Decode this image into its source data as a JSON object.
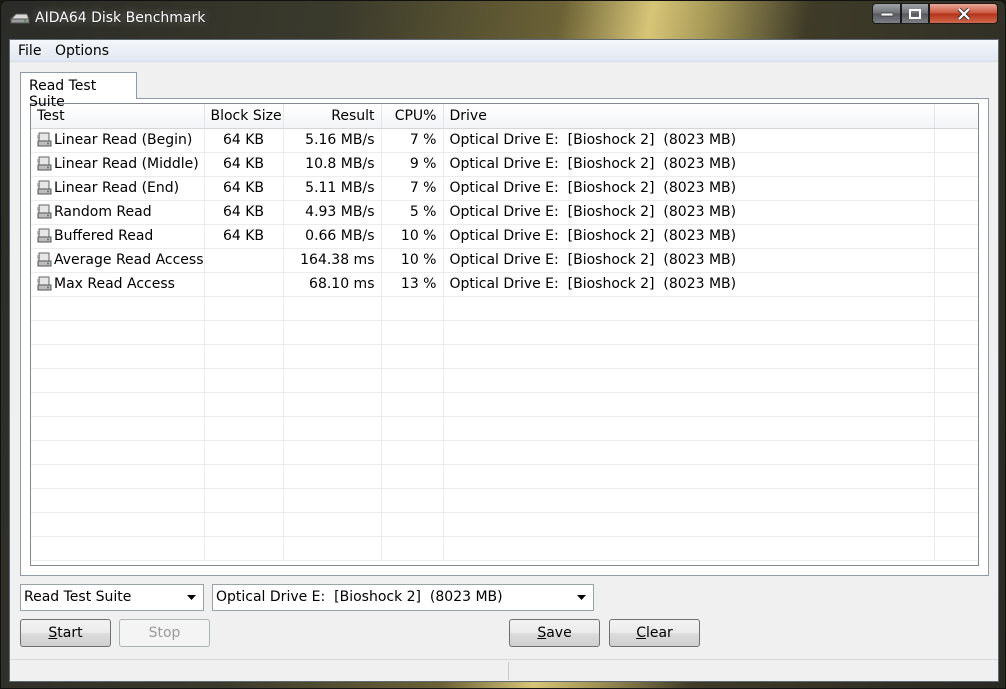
{
  "window": {
    "title": "AIDA64 Disk Benchmark"
  },
  "menu": {
    "file": "File",
    "options": "Options"
  },
  "tab": {
    "label": "Read Test Suite"
  },
  "table": {
    "columns": [
      "Test",
      "Block Size",
      "Result",
      "CPU%",
      "Drive"
    ],
    "rows": [
      {
        "test": "Linear Read (Begin)",
        "block": "64 KB",
        "result": "5.16 MB/s",
        "cpu": "7 %",
        "drive": "Optical Drive E:  [Bioshock 2]  (8023 MB)"
      },
      {
        "test": "Linear Read (Middle)",
        "block": "64 KB",
        "result": "10.8 MB/s",
        "cpu": "9 %",
        "drive": "Optical Drive E:  [Bioshock 2]  (8023 MB)"
      },
      {
        "test": "Linear Read (End)",
        "block": "64 KB",
        "result": "5.11 MB/s",
        "cpu": "7 %",
        "drive": "Optical Drive E:  [Bioshock 2]  (8023 MB)"
      },
      {
        "test": "Random Read",
        "block": "64 KB",
        "result": "4.93 MB/s",
        "cpu": "5 %",
        "drive": "Optical Drive E:  [Bioshock 2]  (8023 MB)"
      },
      {
        "test": "Buffered Read",
        "block": "64 KB",
        "result": "0.66 MB/s",
        "cpu": "10 %",
        "drive": "Optical Drive E:  [Bioshock 2]  (8023 MB)"
      },
      {
        "test": "Average Read Access",
        "block": "",
        "result": "164.38 ms",
        "cpu": "10 %",
        "drive": "Optical Drive E:  [Bioshock 2]  (8023 MB)"
      },
      {
        "test": "Max Read Access",
        "block": "",
        "result": "68.10 ms",
        "cpu": "13 %",
        "drive": "Optical Drive E:  [Bioshock 2]  (8023 MB)"
      }
    ]
  },
  "controls": {
    "suite_select": "Read Test Suite",
    "drive_select": "Optical Drive E:  [Bioshock 2]  (8023 MB)",
    "start": "Start",
    "stop": "Stop",
    "save": "Save",
    "clear": "Clear"
  },
  "icons": {
    "app": "disk-benchmark-icon",
    "row": "drive-icon",
    "dropdown": "chevron-down-icon"
  }
}
